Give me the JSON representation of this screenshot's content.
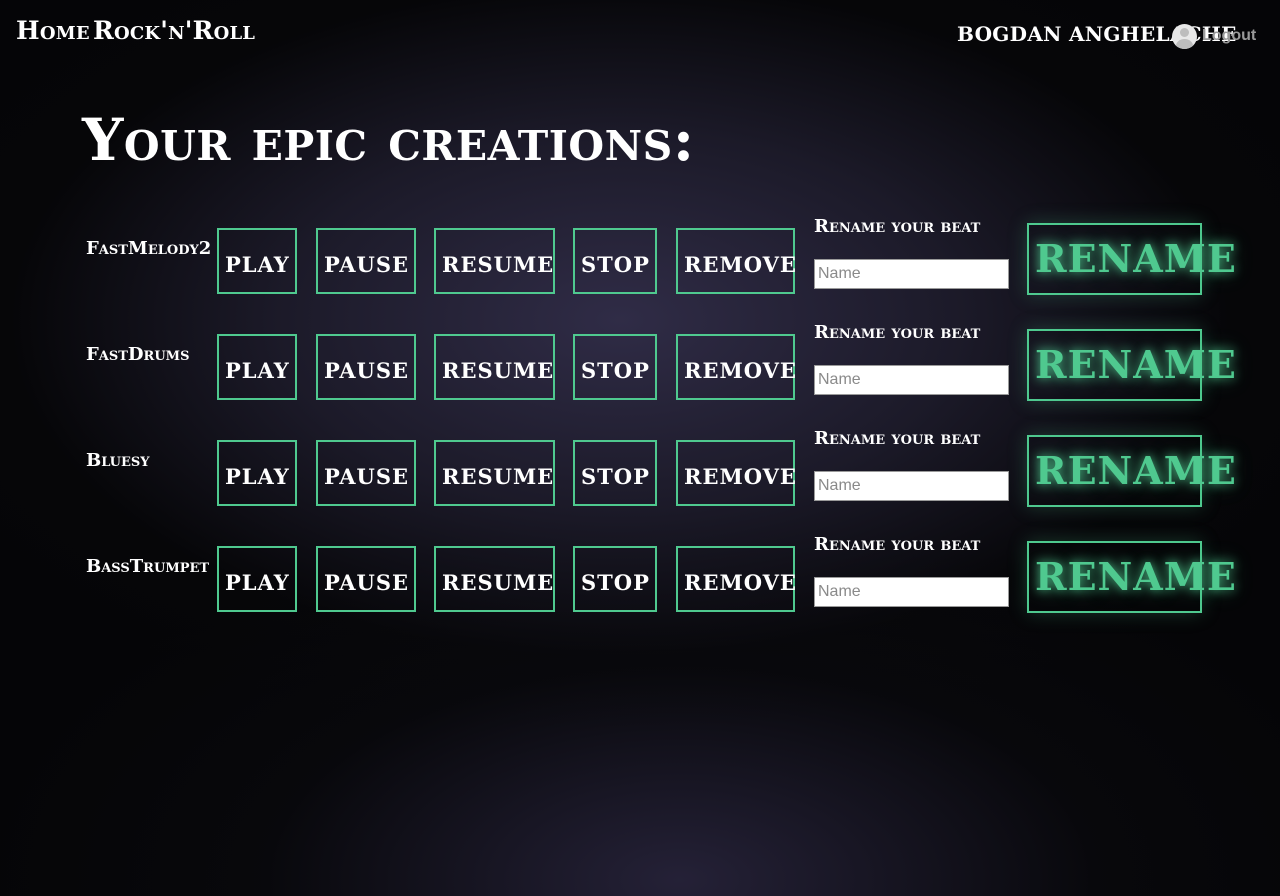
{
  "nav": {
    "home": "Home",
    "brand": "Rock'n'Roll"
  },
  "user": {
    "name": "BOGDAN ANGHELACHE",
    "avatar_icon": "user-avatar-icon",
    "logout": "Logout"
  },
  "page_title": "Your epic creations:",
  "controls": {
    "play": "PLAY",
    "pause": "PAUSE",
    "resume": "RESUME",
    "stop": "STOP",
    "remove": "REMOVE",
    "rename_label": "Rename your beat",
    "name_placeholder": "Name",
    "rename_button": "RENAME"
  },
  "beats": [
    {
      "name": "FastMelody2"
    },
    {
      "name": "FastDrums"
    },
    {
      "name": "Bluesy"
    },
    {
      "name": "BassTrumpet"
    }
  ],
  "colors": {
    "accent": "#4fc98f",
    "background": "#0b0b10",
    "text": "#ffffff",
    "logout_text": "#9a9a9a"
  }
}
